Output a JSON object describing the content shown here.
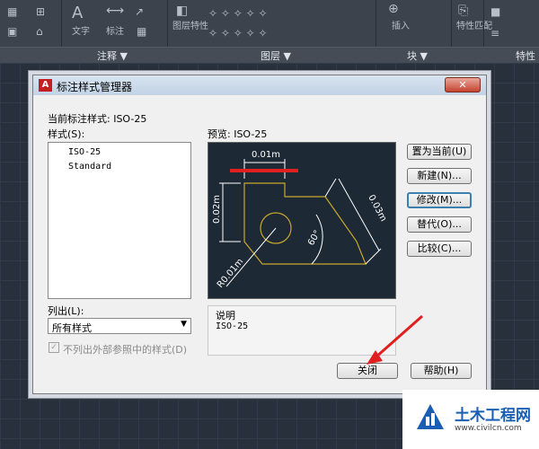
{
  "ribbon": {
    "groups": [
      {
        "label": "注释 ▼"
      },
      {
        "label": "图层 ▼"
      },
      {
        "label": "块 ▼"
      },
      {
        "label": "特性"
      }
    ],
    "tools": {
      "text": "文字",
      "dim": "标注",
      "layer_props": "图层特性",
      "insert": "插入",
      "match": "特性匹配"
    }
  },
  "dialog": {
    "title": "标注样式管理器",
    "close_label": "✕",
    "current_style_label": "当前标注样式: ISO-25",
    "styles_label": "样式(S):",
    "styles": [
      "ISO-25",
      "Standard"
    ],
    "preview_label": "预览: ISO-25",
    "list_label": "列出(L):",
    "list_value": "所有样式",
    "xref_checkbox_label": "不列出外部参照中的样式(D)",
    "description_title": "说明",
    "description_text": "ISO-25",
    "buttons": {
      "set_current": "置为当前(U)",
      "new": "新建(N)...",
      "modify": "修改(M)...",
      "override": "替代(O)...",
      "compare": "比较(C)...",
      "close": "关闭",
      "help": "帮助(H)"
    }
  },
  "preview_dims": {
    "top": "0.01m",
    "left": "0.02m",
    "right": "0.03m",
    "angle": "60°",
    "radius": "R0.01m"
  },
  "colors": {
    "highlight": "#e02020",
    "dim_line": "#ffffff",
    "geometry": "#c8a82c"
  },
  "watermark": {
    "title": "土木工程网",
    "url": "www.civilcn.com"
  }
}
